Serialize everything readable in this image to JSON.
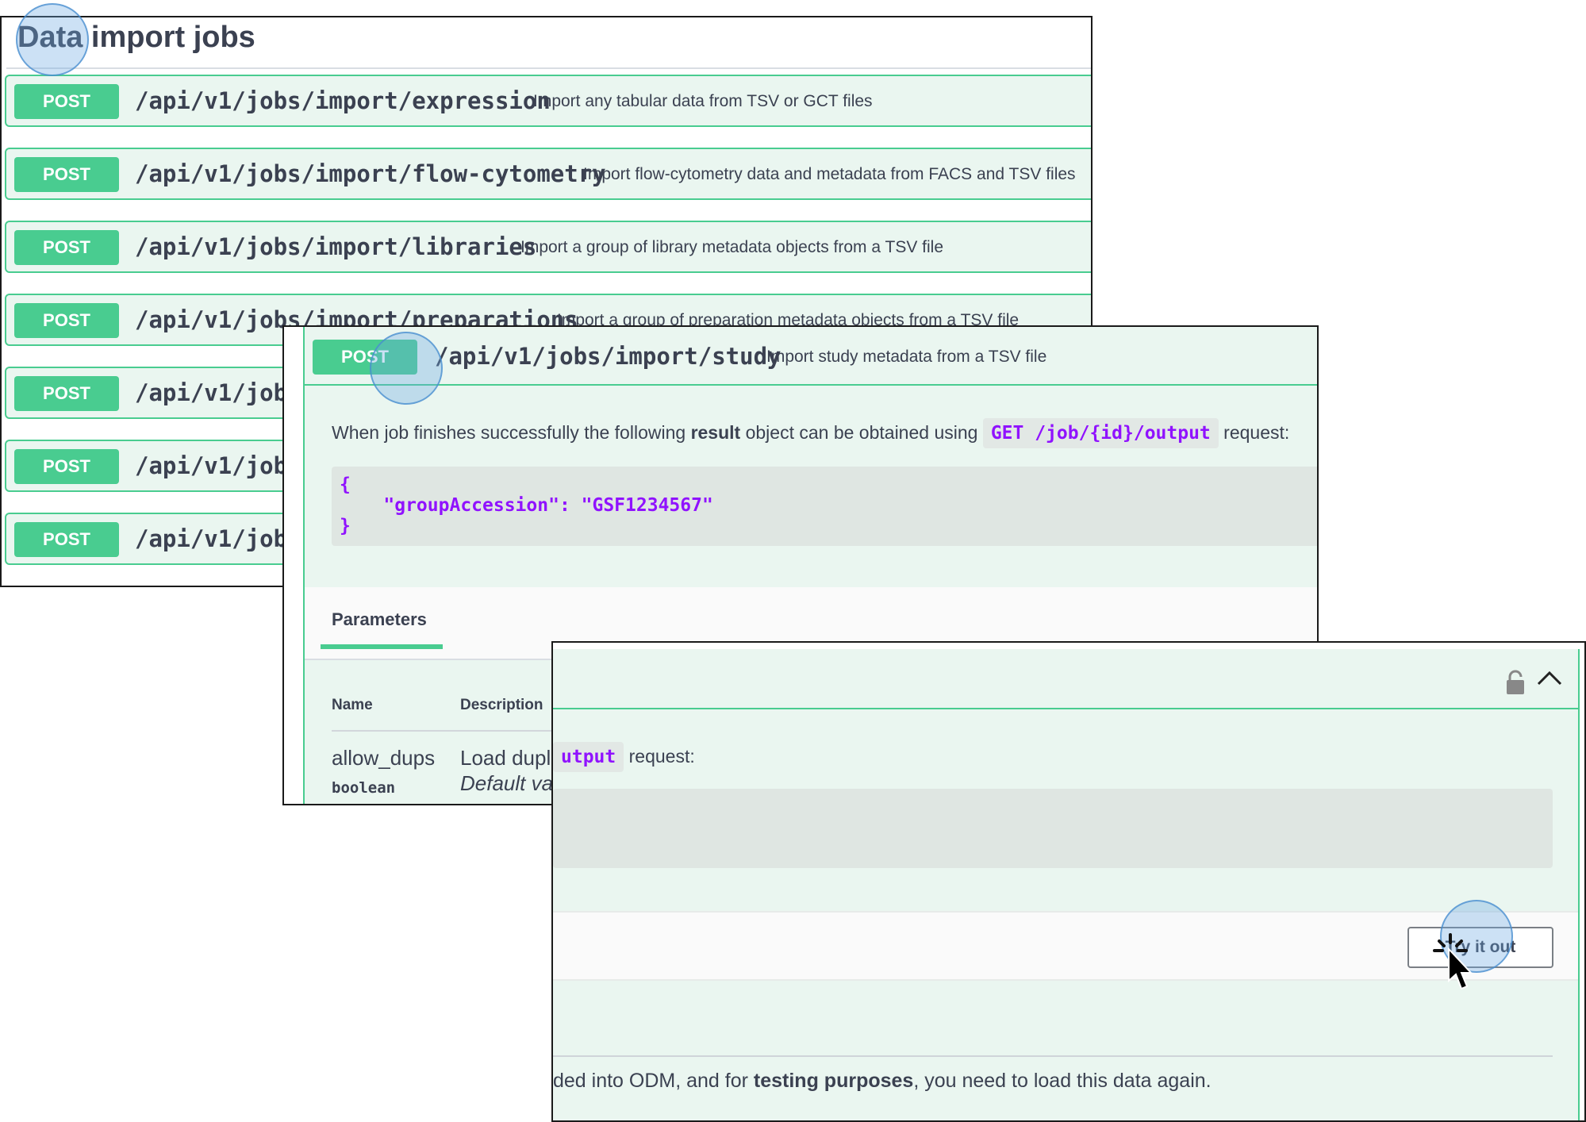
{
  "panel1": {
    "title": "Data import jobs",
    "operations": [
      {
        "method": "POST",
        "path": "/api/v1/jobs/import/expression",
        "description": "Import any tabular data from TSV or GCT files"
      },
      {
        "method": "POST",
        "path": "/api/v1/jobs/import/flow-cytometry",
        "description": "Import flow-cytometry data and metadata from FACS and TSV files"
      },
      {
        "method": "POST",
        "path": "/api/v1/jobs/import/libraries",
        "description": "Import a group of library metadata objects from a TSV file"
      },
      {
        "method": "POST",
        "path": "/api/v1/jobs/import/preparations",
        "description": "Import a group of preparation metadata objects from a TSV file"
      },
      {
        "method": "POST",
        "path": "/api/v1/jobs"
      },
      {
        "method": "POST",
        "path": "/api/v1/jobs"
      },
      {
        "method": "POST",
        "path": "/api/v1/jobs"
      }
    ]
  },
  "panel2": {
    "method": "POST",
    "path": "/api/v1/jobs/import/study",
    "description": "Import study metadata from a TSV file",
    "result_text_pre": "When job finishes successfully the following ",
    "result_text_bold": "result",
    "result_text_mid": " object can be obtained using ",
    "result_code": "GET /job/{id}/output",
    "result_text_post": " request:",
    "code_lines": [
      "{",
      "    \"groupAccession\": \"GSF1234567\"",
      "}"
    ],
    "params_tab": "Parameters",
    "col_name": "Name",
    "col_description": "Description",
    "param": {
      "name": "allow_dups",
      "type": "boolean",
      "desc": "Load dupl",
      "default": "Default va"
    }
  },
  "panel3": {
    "code_tail": "utput",
    "text_after_code": " request:",
    "try_button": "Try it out",
    "footer_pre": "ded into ODM, and for ",
    "footer_bold": "testing purposes",
    "footer_post": ", you need to load this data again."
  },
  "icons": {
    "lock": "lock-icon",
    "chevron": "chevron-up-icon",
    "cursor": "click-cursor-icon"
  },
  "colors": {
    "post_green": "#49cc90",
    "post_bg": "#eaf6f0",
    "code_purple": "#9012fe",
    "text": "#3b4151"
  }
}
